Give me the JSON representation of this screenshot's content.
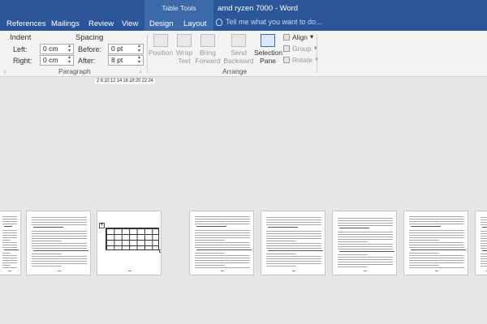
{
  "titlebar": {
    "context_group": "Table Tools",
    "document_title": "amd ryzen 7000 - Word",
    "tell_me_placeholder": "Tell me what you want to do..."
  },
  "tabs": [
    {
      "label": "References"
    },
    {
      "label": "Mailings"
    },
    {
      "label": "Review"
    },
    {
      "label": "View"
    },
    {
      "label": "Design"
    },
    {
      "label": "Layout"
    }
  ],
  "paragraph": {
    "indent_label": "Indent",
    "left_label": "Left:",
    "right_label": "Right:",
    "left_value": "0 cm",
    "right_value": "0 cm",
    "spacing_label": "Spacing",
    "before_label": "Before:",
    "after_label": "After:",
    "before_value": "0 pt",
    "after_value": "8 pt",
    "group_label": "Paragraph"
  },
  "arrange": {
    "position": "Position",
    "wrap_text": [
      "Wrap",
      "Text"
    ],
    "bring_forward": [
      "Bring",
      "Forward"
    ],
    "send_backward": [
      "Send",
      "Backward"
    ],
    "selection_pane": [
      "Selection",
      "Pane"
    ],
    "align": "Align",
    "group": "Group",
    "rotate": "Rotate",
    "group_label": "Arrange"
  },
  "ruler": {
    "text": "2 8 10 12 14 16 18 20 22 24"
  },
  "colors": {
    "accent": "#2b579a",
    "context": "#3c6aa9",
    "canvas": "#e6e6e6"
  }
}
